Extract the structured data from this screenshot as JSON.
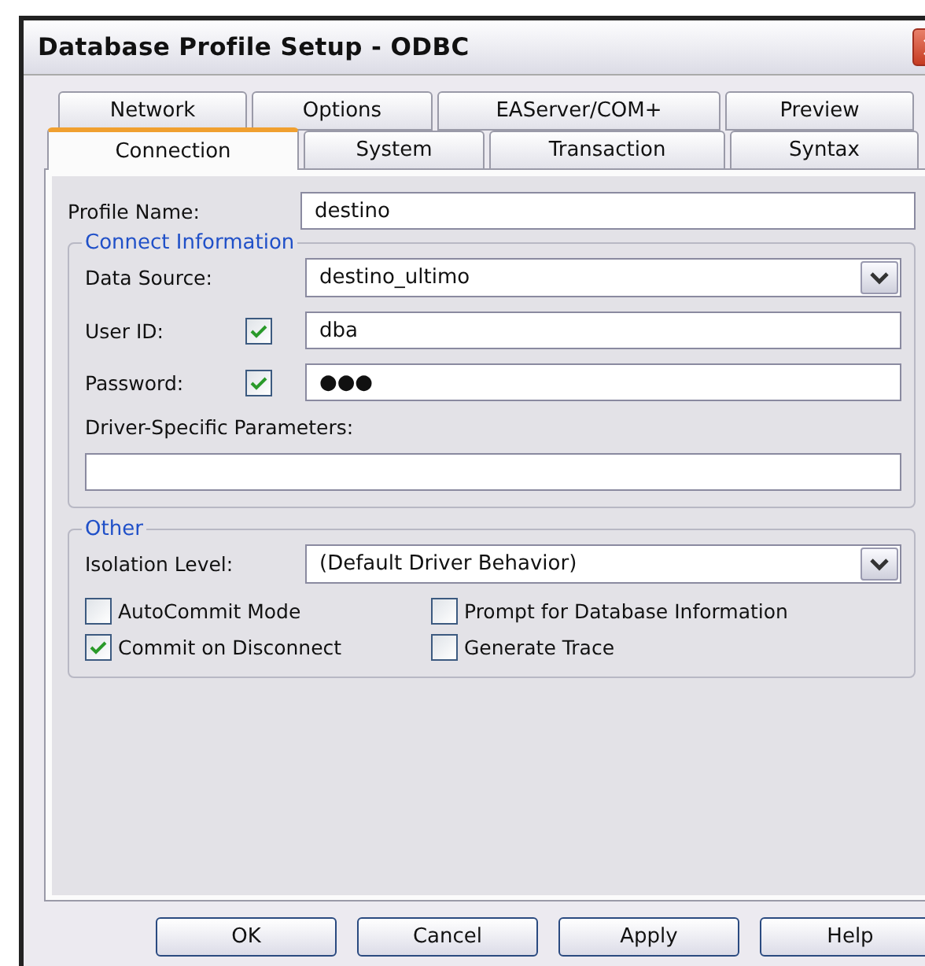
{
  "window": {
    "title": "Database Profile Setup - ODBC"
  },
  "tab_rows": [
    [
      {
        "label": "Network",
        "selected": false
      },
      {
        "label": "Options",
        "selected": false
      },
      {
        "label": "EAServer/COM+",
        "selected": false
      },
      {
        "label": "Preview",
        "selected": false
      }
    ],
    [
      {
        "label": "Connection",
        "selected": true
      },
      {
        "label": "System",
        "selected": false
      },
      {
        "label": "Transaction",
        "selected": false
      },
      {
        "label": "Syntax",
        "selected": false
      }
    ]
  ],
  "profile_name": {
    "label": "Profile Name:",
    "value": "destino"
  },
  "connect_information": {
    "title": "Connect Information",
    "data_source": {
      "label": "Data Source:",
      "value": "destino_ultimo"
    },
    "user_id": {
      "label": "User ID:",
      "checked": true,
      "value": "dba"
    },
    "password": {
      "label": "Password:",
      "checked": true,
      "value": "●●●"
    },
    "driver_parameters": {
      "label": "Driver-Specific Parameters:"
    }
  },
  "other": {
    "title": "Other",
    "isolation_level": {
      "label": "Isolation Level:",
      "value": "(Default Driver Behavior)"
    },
    "options": [
      {
        "label": "AutoCommit Mode",
        "checked": false
      },
      {
        "label": "Prompt for Database Information",
        "checked": false
      },
      {
        "label": "Commit on Disconnect",
        "checked": true
      },
      {
        "label": "Generate Trace",
        "checked": false
      }
    ]
  },
  "buttons": [
    "OK",
    "Cancel",
    "Apply",
    "Help"
  ]
}
